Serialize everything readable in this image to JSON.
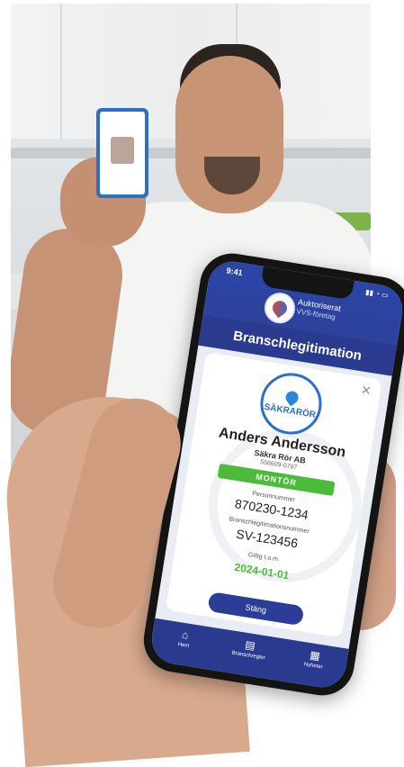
{
  "phone": {
    "status_time": "9:41",
    "brand_line1": "Auktoriserat",
    "brand_line2": "VVS-företag",
    "screen_title": "Branschlegitimation",
    "company_logo_text": "SÄKRARÖR",
    "holder_name": "Anders Andersson",
    "company_name": "Säkra Rör AB",
    "org_number": "556609-0797",
    "role": "MONTÖR",
    "personal_number_label": "Personnummer",
    "personal_number": "870230-1234",
    "license_number_label": "Branschlegitimationsnummer",
    "license_number": "SV-123456",
    "valid_label": "Giltig t.o.m.",
    "valid_until": "2024-01-01",
    "close_button": "Stäng",
    "tabs": [
      {
        "label": "Hem",
        "icon": "home-icon"
      },
      {
        "label": "Branschregler",
        "icon": "book-icon"
      },
      {
        "label": "Nyheter",
        "icon": "news-icon"
      }
    ]
  },
  "colors": {
    "header_blue": "#2b45a6",
    "role_green": "#4cbb3c",
    "button_blue": "#2c3d97"
  }
}
